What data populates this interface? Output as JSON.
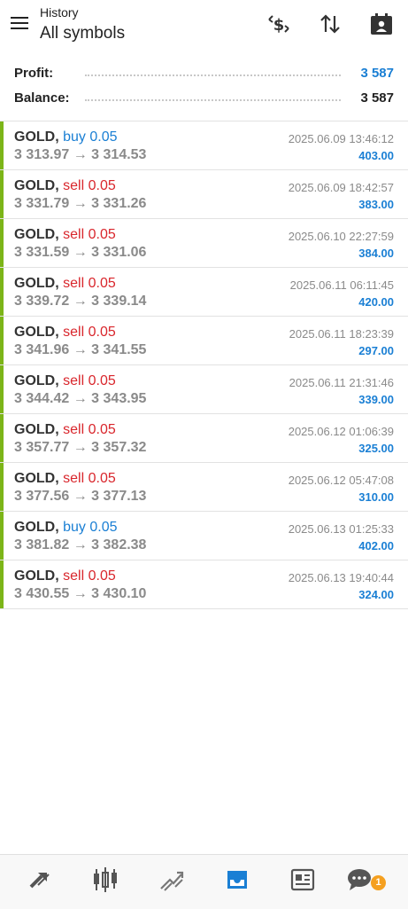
{
  "header": {
    "subtitle": "History",
    "title": "All symbols"
  },
  "summary": {
    "profit_label": "Profit:",
    "profit_value": "3 587",
    "balance_label": "Balance:",
    "balance_value": "3 587"
  },
  "deals": [
    {
      "symbol": "GOLD,",
      "dir": "buy",
      "volume": "0.05",
      "prices": "3 313.97 → 3 314.53",
      "time": "2025.06.09 13:46:12",
      "profit": "403.00"
    },
    {
      "symbol": "GOLD,",
      "dir": "sell",
      "volume": "0.05",
      "prices": "3 331.79 → 3 331.26",
      "time": "2025.06.09 18:42:57",
      "profit": "383.00"
    },
    {
      "symbol": "GOLD,",
      "dir": "sell",
      "volume": "0.05",
      "prices": "3 331.59 → 3 331.06",
      "time": "2025.06.10 22:27:59",
      "profit": "384.00"
    },
    {
      "symbol": "GOLD,",
      "dir": "sell",
      "volume": "0.05",
      "prices": "3 339.72 → 3 339.14",
      "time": "2025.06.11 06:11:45",
      "profit": "420.00"
    },
    {
      "symbol": "GOLD,",
      "dir": "sell",
      "volume": "0.05",
      "prices": "3 341.96 → 3 341.55",
      "time": "2025.06.11 18:23:39",
      "profit": "297.00"
    },
    {
      "symbol": "GOLD,",
      "dir": "sell",
      "volume": "0.05",
      "prices": "3 344.42 → 3 343.95",
      "time": "2025.06.11 21:31:46",
      "profit": "339.00"
    },
    {
      "symbol": "GOLD,",
      "dir": "sell",
      "volume": "0.05",
      "prices": "3 357.77 → 3 357.32",
      "time": "2025.06.12 01:06:39",
      "profit": "325.00"
    },
    {
      "symbol": "GOLD,",
      "dir": "sell",
      "volume": "0.05",
      "prices": "3 377.56 → 3 377.13",
      "time": "2025.06.12 05:47:08",
      "profit": "310.00"
    },
    {
      "symbol": "GOLD,",
      "dir": "buy",
      "volume": "0.05",
      "prices": "3 381.82 → 3 382.38",
      "time": "2025.06.13 01:25:33",
      "profit": "402.00"
    },
    {
      "symbol": "GOLD,",
      "dir": "sell",
      "volume": "0.05",
      "prices": "3 430.55 → 3 430.10",
      "time": "2025.06.13 19:40:44",
      "profit": "324.00"
    }
  ],
  "bottom_nav": {
    "items": [
      "quotes-icon",
      "chart-icon",
      "trade-icon",
      "history-icon",
      "news-icon",
      "chat-icon"
    ],
    "active": "history-icon",
    "chat_badge": "1"
  },
  "colors": {
    "accent": "#1a7fd4",
    "sell": "#d9262c",
    "deal_bar": "#7cb518",
    "badge": "#f5a020"
  }
}
